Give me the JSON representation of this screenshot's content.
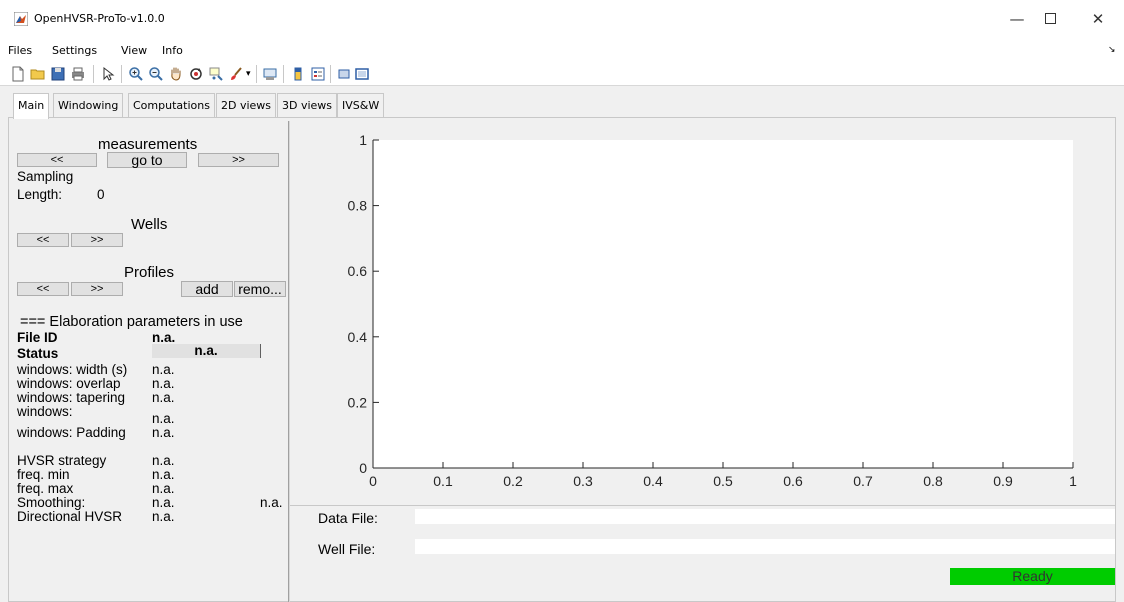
{
  "window": {
    "title": "OpenHVSR-ProTo-v1.0.0",
    "controls": {
      "minimize": "—",
      "close": "✕"
    }
  },
  "menu": {
    "files": "Files",
    "settings": "Settings",
    "view": "View",
    "info": "Info"
  },
  "toolbar": {
    "icons": [
      "new-file-icon",
      "open-folder-icon",
      "save-icon",
      "print-icon",
      "select-arrow-icon",
      "zoom-in-icon",
      "zoom-out-icon",
      "pan-hand-icon",
      "rotate-icon",
      "data-cursor-icon",
      "brush-icon",
      "link-icon",
      "colorbar-icon",
      "legend-icon",
      "hide-plot-tools-icon",
      "show-plot-tools-icon"
    ]
  },
  "tabs": [
    "Main",
    "Windowing",
    "Computations",
    "2D views",
    "3D views",
    "IVS&W"
  ],
  "left": {
    "measurements": {
      "title": "measurements",
      "prev": "<<",
      "goto": "go to",
      "next": ">>",
      "sampling": "Sampling",
      "length_label": "Length:",
      "length_value": "0"
    },
    "wells": {
      "title": "Wells",
      "prev": "<<",
      "next": ">>"
    },
    "profiles": {
      "title": "Profiles",
      "prev": "<<",
      "next": ">>",
      "add": "add",
      "remove": "remo..."
    },
    "params": {
      "header": "=== Elaboration parameters in use",
      "file_id_label": "File ID",
      "file_id_value": "n.a.",
      "status_label": "Status",
      "status_value": "n.a.",
      "win_width_label": "windows:  width (s)",
      "win_width_value": "n.a.",
      "win_overlap_label": "windows:  overlap",
      "win_overlap_value": "n.a.",
      "win_tapering_label": "windows:  tapering",
      "win_tapering_value": "n.a.",
      "win_blank_label": "windows:",
      "win_blank_value": "n.a.",
      "win_padding_label": "windows:  Padding",
      "win_padding_value": "n.a.",
      "hvsr_strategy_label": "HVSR strategy",
      "hvsr_strategy_value": "n.a.",
      "freq_min_label": "freq. min",
      "freq_min_value": "n.a.",
      "freq_max_label": "freq. max",
      "freq_max_value": "n.a.",
      "smoothing_label": "Smoothing:",
      "smoothing_value": "n.a.",
      "smoothing_value2": "n.a.",
      "directional_label": "Directional HVSR",
      "directional_value": "n.a."
    }
  },
  "chart_data": {
    "type": "line",
    "series": [],
    "xlim": [
      0,
      1
    ],
    "ylim": [
      0,
      1
    ],
    "xticks": [
      "0",
      "0.1",
      "0.2",
      "0.3",
      "0.4",
      "0.5",
      "0.6",
      "0.7",
      "0.8",
      "0.9",
      "1"
    ],
    "yticks": [
      "0",
      "0.2",
      "0.4",
      "0.6",
      "0.8",
      "1"
    ],
    "title": "",
    "xlabel": "",
    "ylabel": "",
    "grid": false
  },
  "bottom": {
    "data_file_label": "Data File:",
    "data_file_value": "",
    "well_file_label": "Well File:",
    "well_file_value": "",
    "status": "Ready",
    "status_color": "#00cc00"
  }
}
